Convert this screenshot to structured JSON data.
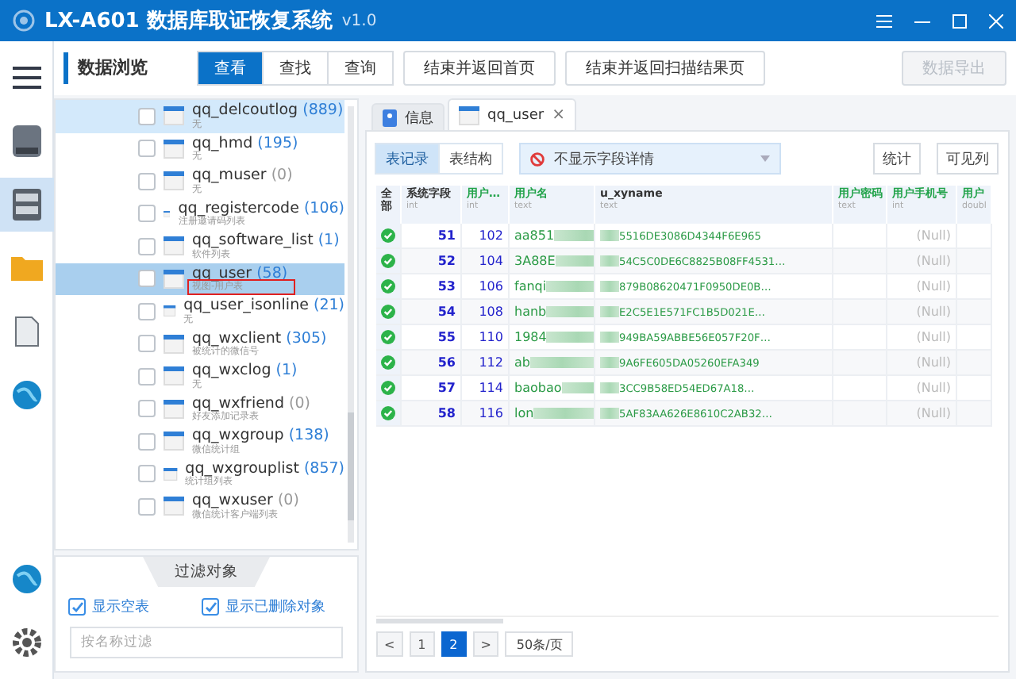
{
  "window": {
    "title": "LX-A601 数据库取证恢复系统",
    "version": "v1.0"
  },
  "nav": [
    {
      "kind": "menu",
      "selected": false
    },
    {
      "kind": "disk",
      "selected": false
    },
    {
      "kind": "database",
      "selected": true
    },
    {
      "kind": "folder",
      "selected": false
    },
    {
      "kind": "file",
      "selected": false
    },
    {
      "kind": "globe",
      "selected": false
    }
  ],
  "nav_bottom": [
    {
      "kind": "globe"
    },
    {
      "kind": "gear"
    }
  ],
  "toolbar": {
    "section": "数据浏览",
    "modes": [
      {
        "label": "查看",
        "selected": true
      },
      {
        "label": "查找",
        "selected": false
      },
      {
        "label": "查询",
        "selected": false
      }
    ],
    "actions": [
      "结束并返回首页",
      "结束并返回扫描结果页"
    ],
    "export": {
      "label": "数据导出",
      "disabled": true
    }
  },
  "tables": [
    {
      "name": "qq_delcoutlog",
      "count": "(889)",
      "empty": false,
      "description": "无",
      "selected": false,
      "hovered": true,
      "annotated": false
    },
    {
      "name": "qq_hmd",
      "count": "(195)",
      "empty": false,
      "description": "无",
      "selected": false,
      "hovered": false,
      "annotated": false
    },
    {
      "name": "qq_muser",
      "count": "(0)",
      "empty": true,
      "description": "无",
      "selected": false,
      "hovered": false,
      "annotated": false
    },
    {
      "name": "qq_registercode",
      "count": "(106)",
      "empty": false,
      "description": "注册邀请码列表",
      "selected": false,
      "hovered": false,
      "annotated": false
    },
    {
      "name": "qq_software_list",
      "count": "(1)",
      "empty": false,
      "description": "软件列表",
      "selected": false,
      "hovered": false,
      "annotated": false
    },
    {
      "name": "qq_user",
      "count": "(58)",
      "empty": false,
      "description": "视图-用户表",
      "selected": true,
      "hovered": false,
      "annotated": true
    },
    {
      "name": "qq_user_isonline",
      "count": "(21)",
      "empty": false,
      "description": "无",
      "selected": false,
      "hovered": false,
      "annotated": false
    },
    {
      "name": "qq_wxclient",
      "count": "(305)",
      "empty": false,
      "description": "被统计的微信号",
      "selected": false,
      "hovered": false,
      "annotated": false
    },
    {
      "name": "qq_wxclog",
      "count": "(1)",
      "empty": false,
      "description": "无",
      "selected": false,
      "hovered": false,
      "annotated": false
    },
    {
      "name": "qq_wxfriend",
      "count": "(0)",
      "empty": true,
      "description": "好友添加记录表",
      "selected": false,
      "hovered": false,
      "annotated": false
    },
    {
      "name": "qq_wxgroup",
      "count": "(138)",
      "empty": false,
      "description": "微信统计组",
      "selected": false,
      "hovered": false,
      "annotated": false
    },
    {
      "name": "qq_wxgrouplist",
      "count": "(857)",
      "empty": false,
      "description": "统计组列表",
      "selected": false,
      "hovered": false,
      "annotated": false
    },
    {
      "name": "qq_wxuser",
      "count": "(0)",
      "empty": true,
      "description": "微信统计客户端列表",
      "selected": false,
      "hovered": false,
      "annotated": false
    }
  ],
  "filter": {
    "title": "过滤对象",
    "options": [
      {
        "label": "显示空表",
        "checked": true
      },
      {
        "label": "显示已删除对象",
        "checked": true
      }
    ],
    "placeholder": "按名称过滤"
  },
  "doc_tabs": [
    {
      "label": "信息",
      "kind": "info",
      "selected": false,
      "closable": false
    },
    {
      "label": "qq_user",
      "kind": "table",
      "selected": true,
      "closable": true
    }
  ],
  "close_glyph": "×",
  "view_modes": [
    {
      "label": "表记录",
      "selected": true
    },
    {
      "label": "表结构",
      "selected": false
    }
  ],
  "detail_select": "不显示字段详情",
  "grid_buttons": [
    "统计",
    "可见列"
  ],
  "columns": [
    {
      "title": "全部",
      "highlight": false,
      "kind": "status"
    },
    {
      "title": "系统字段",
      "type": "int",
      "highlight": false,
      "kind": "num"
    },
    {
      "title": "用户…",
      "type": "int",
      "highlight": true,
      "kind": "num"
    },
    {
      "title": "用户名",
      "type": "text",
      "highlight": true,
      "kind": "left"
    },
    {
      "title": "u_xyname",
      "type": "text",
      "highlight": false,
      "kind": "right"
    },
    {
      "title": "用户密码",
      "type": "text",
      "highlight": true,
      "kind": "empty"
    },
    {
      "title": "用户手机号",
      "type": "int",
      "highlight": true,
      "kind": "null"
    },
    {
      "title": "用户",
      "type": "doubl",
      "highlight": true,
      "kind": "empty"
    }
  ],
  "rows": [
    {
      "ok": true,
      "sys": "51",
      "id": "102",
      "name": "aa851",
      "xyname": "5516DE3086D4344F6E965",
      "phone": "(Null)"
    },
    {
      "ok": true,
      "sys": "52",
      "id": "104",
      "name": "3A88E",
      "xyname": "54C5C0DE6C8825B08FF4531…",
      "phone": "(Null)"
    },
    {
      "ok": true,
      "sys": "53",
      "id": "106",
      "name": "fanqi",
      "xyname": "879B08620471F0950DE0B…",
      "phone": "(Null)"
    },
    {
      "ok": true,
      "sys": "54",
      "id": "108",
      "name": "hanb",
      "xyname": "E2C5E1E571FC1B5D021E…",
      "phone": "(Null)"
    },
    {
      "ok": true,
      "sys": "55",
      "id": "110",
      "name": "1984",
      "xyname": "949BA59ABBE56E057F20F…",
      "phone": "(Null)"
    },
    {
      "ok": true,
      "sys": "56",
      "id": "112",
      "name": "ab",
      "xyname": "9A6FE605DA05260EFA349",
      "phone": "(Null)"
    },
    {
      "ok": true,
      "sys": "57",
      "id": "114",
      "name": "baobao",
      "xyname": "3CC9B58ED54ED67A18…",
      "phone": "(Null)"
    },
    {
      "ok": true,
      "sys": "58",
      "id": "116",
      "name": "lon",
      "xyname": "5AF83AA626E8610C2AB32…",
      "phone": "(Null)"
    }
  ],
  "pagination": {
    "prev": "<",
    "pages": [
      {
        "label": "1",
        "selected": false
      },
      {
        "label": "2",
        "selected": true
      }
    ],
    "next": ">",
    "page_size": "50条/页"
  }
}
